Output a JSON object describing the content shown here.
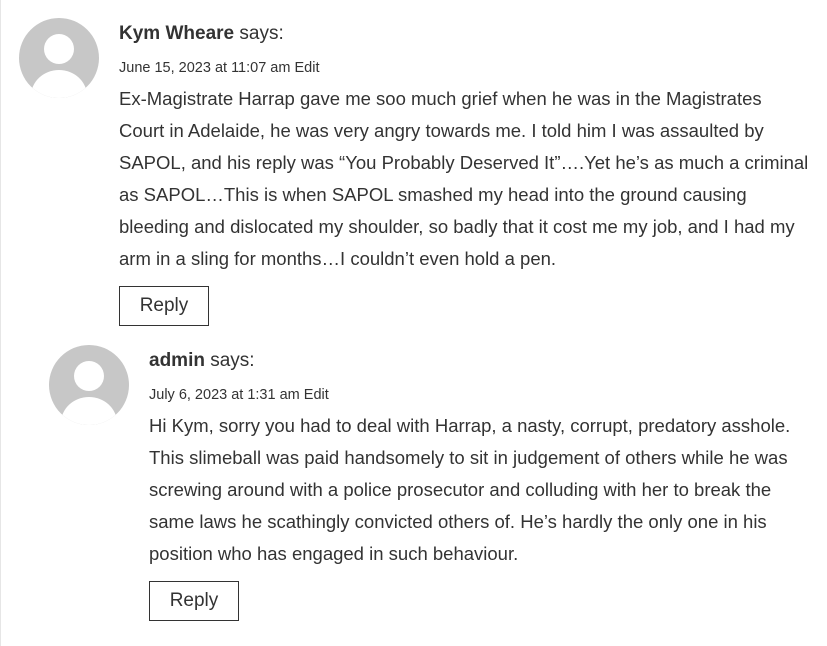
{
  "comments": [
    {
      "author": "Kym Wheare",
      "says": "says:",
      "date": "June 15, 2023 at 11:07 am",
      "edit_label": "Edit",
      "avatar_icon": "default-avatar-icon",
      "text": "Ex-Magistrate Harrap gave me soo much grief when he was in the Magistrates Court in Adelaide, he was very angry towards me. I told him I was assaulted by SAPOL, and his reply was “You Probably Deserved It”….Yet he’s as much a criminal as SAPOL…This is when SAPOL smashed my head into the ground causing bleeding and dislocated my shoulder, so badly that it cost me my job, and I had my arm in a sling for months…I couldn’t even hold a pen.",
      "reply_label": "Reply"
    },
    {
      "author": "admin",
      "says": "says:",
      "date": "July 6, 2023 at 1:31 am",
      "edit_label": "Edit",
      "avatar_icon": "default-avatar-icon",
      "text": "Hi Kym, sorry you had to deal with Harrap, a nasty, corrupt, predatory asshole. This slimeball was paid handsomely to sit in judgement of others while he was screwing around with a police prosecutor and colluding with her to break the same laws he scathingly convicted others of. He’s hardly the only one in his position who has engaged in such behaviour.",
      "reply_label": "Reply"
    }
  ],
  "colors": {
    "text": "#333333",
    "avatar_bg": "#c7c7c7",
    "avatar_silhouette": "#ffffff",
    "reply_border": "#333333"
  }
}
